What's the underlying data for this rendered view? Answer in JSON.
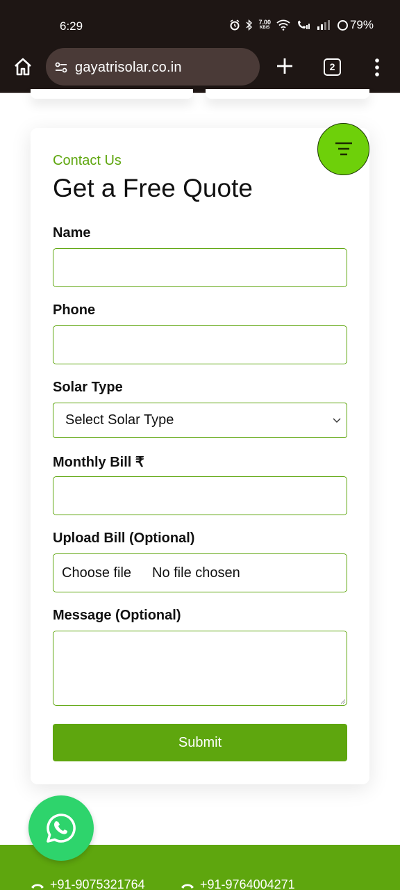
{
  "status_bar": {
    "time": "6:29",
    "net_speed_value": "7.00",
    "net_speed_unit": "KB/S",
    "battery": "79%"
  },
  "browser": {
    "url": "gayatrisolar.co.in",
    "tab_count": "2"
  },
  "form": {
    "eyebrow": "Contact Us",
    "title": "Get a Free Quote",
    "name_label": "Name",
    "phone_label": "Phone",
    "solar_type_label": "Solar Type",
    "solar_type_selected": "Select Solar Type",
    "monthly_bill_label": "Monthly Bill ₹",
    "upload_label": "Upload Bill (Optional)",
    "file_button": "Choose file",
    "file_status": "No file chosen",
    "message_label": "Message (Optional)",
    "submit_label": "Submit"
  },
  "footer": {
    "phone_1": "+91-9075321764",
    "phone_2": "+91-9764004271"
  },
  "colors": {
    "accent": "#5ea60e",
    "menu_button": "#6ed00a",
    "whatsapp": "#2ed46c",
    "browser_chrome": "#1e1614"
  },
  "icons": [
    "home-icon",
    "site-settings-icon",
    "plus-icon",
    "tabs-icon",
    "more-vert-icon",
    "menu-icon",
    "chevron-down-icon",
    "whatsapp-icon",
    "phone-icon",
    "alarm-icon",
    "bluetooth-icon",
    "wifi-icon",
    "signal-icon"
  ]
}
